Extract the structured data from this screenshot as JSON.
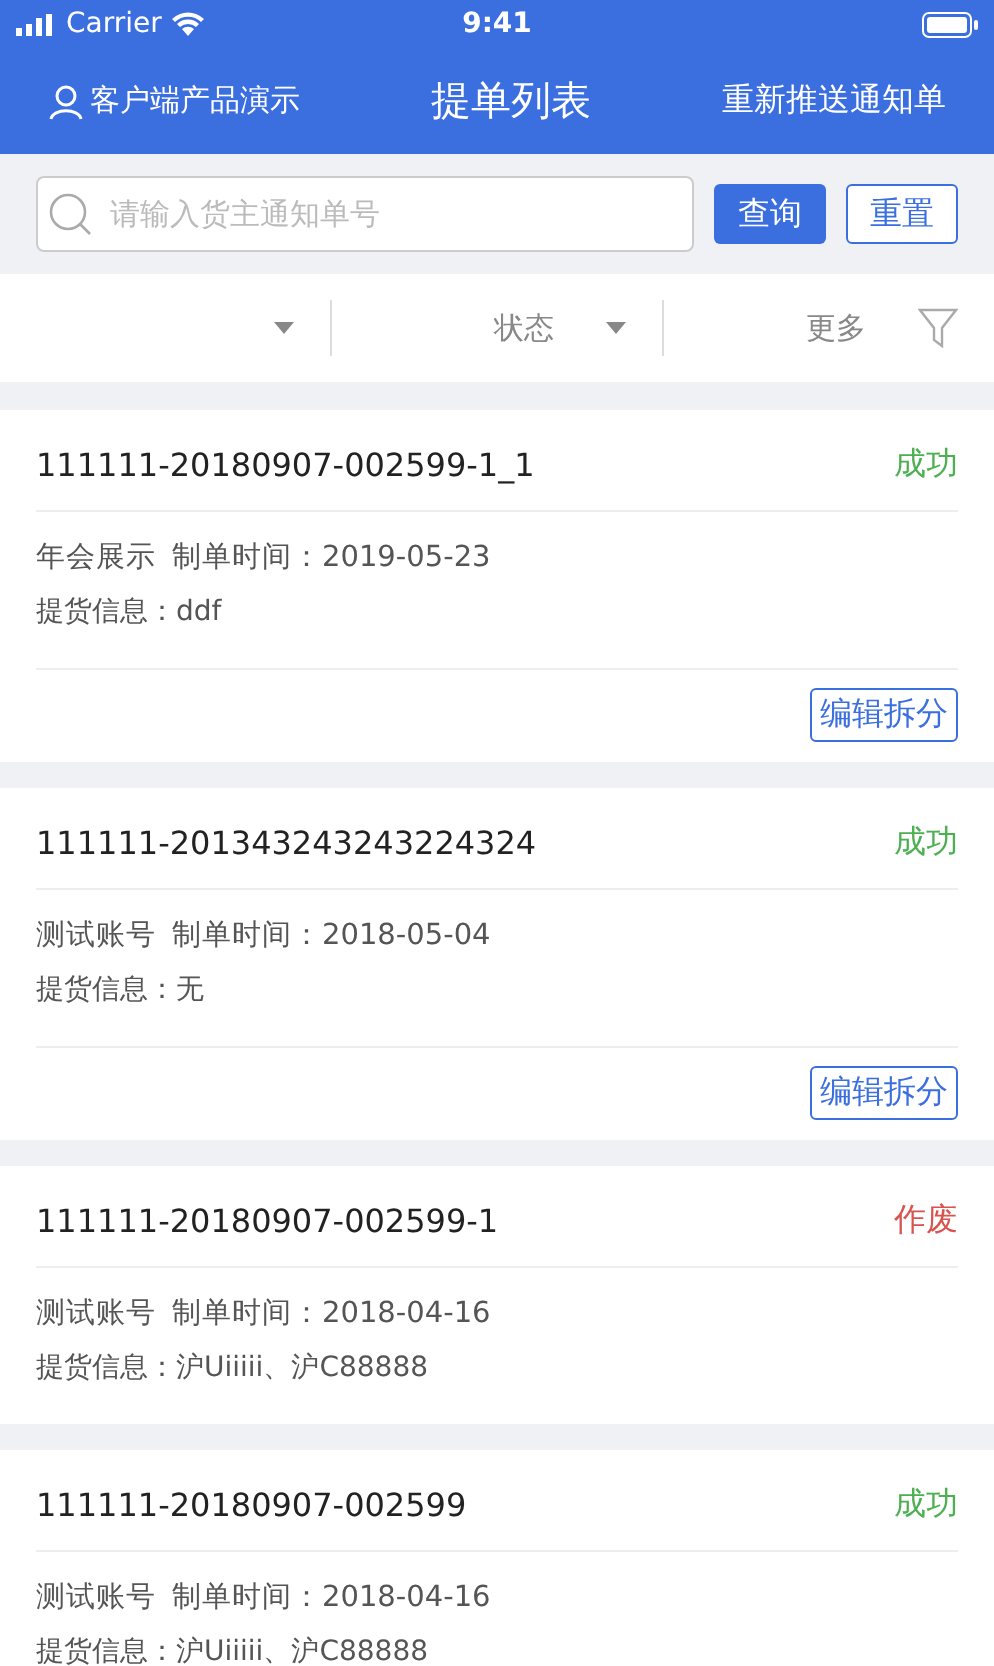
{
  "status_bar": {
    "carrier": "Carrier",
    "time": "9:41"
  },
  "nav": {
    "account": "客户端产品演示",
    "title": "提单列表",
    "action": "重新推送通知单"
  },
  "search": {
    "placeholder": "请输入货主通知单号",
    "query_button": "查询",
    "reset_button": "重置"
  },
  "filters": [
    {
      "kind": "dropdown"
    },
    {
      "kind": "dropdown",
      "label": "状态"
    },
    {
      "kind": "filter",
      "label": "更多"
    }
  ],
  "orders": [
    {
      "number": "111111-20180907-002599-1_1",
      "status": "成功",
      "color": "#4caf50",
      "account": "年会展示",
      "created": "制单时间：2019-05-23",
      "pickup": "提货信息：ddf",
      "split_button": "编辑拆分"
    },
    {
      "number": "111111-201343243243224324",
      "status": "成功",
      "color": "#4caf50",
      "account": "测试账号",
      "created": "制单时间：2018-05-04",
      "pickup": "提货信息：无",
      "split_button": "编辑拆分"
    },
    {
      "number": "111111-20180907-002599-1",
      "status": "作废",
      "color": "#d9534f",
      "account": "测试账号",
      "created": "制单时间：2018-04-16",
      "pickup": "提货信息：沪Uiiiii、沪C88888"
    },
    {
      "number": "111111-20180907-002599",
      "status": "成功",
      "color": "#4caf50",
      "account": "测试账号",
      "created": "制单时间：2018-04-16",
      "pickup": "提货信息：沪Uiiiii、沪C88888"
    }
  ]
}
